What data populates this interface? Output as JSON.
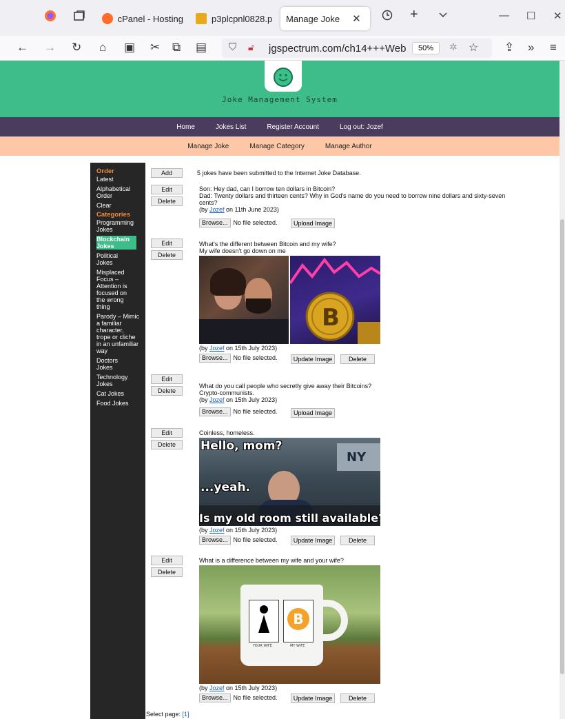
{
  "browser": {
    "tabs": [
      {
        "label": "cPanel - Hosting"
      },
      {
        "label": "p3plcpnl0828.p"
      },
      {
        "label": "Manage Joke"
      }
    ],
    "url": "jgspectrum.com/ch14+++Web",
    "zoom": "50%"
  },
  "site": {
    "title": "Joke Management System",
    "nav": [
      "Home",
      "Jokes List",
      "Register Account",
      "Log out: Jozef"
    ],
    "subnav": [
      "Manage Joke",
      "Manage Category",
      "Manage Author"
    ]
  },
  "sidebar": {
    "order_heading": "Order",
    "order_items": [
      "Latest",
      "Alphabetical Order",
      "Clear"
    ],
    "categories_heading": "Categories",
    "categories": [
      "Programming Jokes",
      "Blockchain Jokes",
      "Political Jokes",
      "Misplaced Focus – Attention is focused on the wrong thing",
      "Parody – Mimic a familiar character, trope or cliche in an unfamiliar way",
      "Doctors Jokes",
      "Technology Jokes",
      "Cat Jokes",
      "Food Jokes"
    ]
  },
  "main": {
    "add_label": "Add",
    "summary": "5 jokes have been submitted to the Internet Joke Database.",
    "edit_label": "Edit",
    "delete_label": "Delete",
    "browse_label": "Browse...",
    "no_file": "No file selected.",
    "upload_label": "Upload Image",
    "update_label": "Update Image",
    "delete_image_label": "Delete",
    "by_prefix": "(by ",
    "jokes": [
      {
        "line1": "Son: Hey dad, can I borrow ten dollars in Bitcoin?",
        "line2": "Dad: Twenty dollars and thirteen cents? Why in God's name do you need to borrow nine dollars and sixty-seven",
        "line3": "cents?",
        "author": "Jozef",
        "date": " on 11th June 2023)"
      },
      {
        "line1": "What's the different between Bitcoin and my wife?",
        "line2": "My wife doesn't go down on me",
        "author": "Jozef",
        "date": " on 15th July 2023)"
      },
      {
        "line1": "What do you call people who secretly give away their Bitcoins?",
        "line2": "Crypto-communists.",
        "author": "Jozef",
        "date": " on 15th July 2023)"
      },
      {
        "line1": "Coinless, homeless.",
        "author": "Jozef",
        "date": " on 15th July 2023)",
        "meme": [
          "Hello, mom?",
          "...yeah.",
          "Is my old room still available?"
        ]
      },
      {
        "line1": "What is a difference between my wife and your wife?",
        "author": "Jozef",
        "date": " on 15th July 2023)",
        "mug": [
          "YOUR WIFE",
          "MY WIFE"
        ]
      }
    ],
    "pagination_label": "Select page: ",
    "pagination_link": "[1]"
  }
}
